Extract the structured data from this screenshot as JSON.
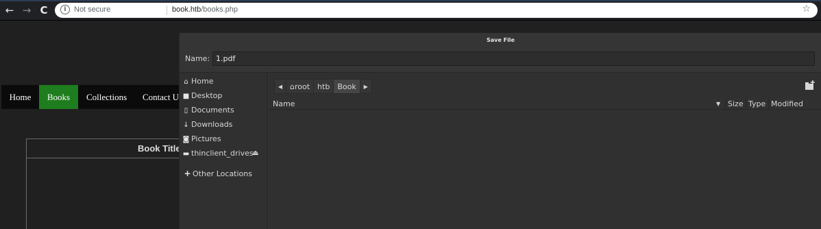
{
  "browser": {
    "back_icon": "arrow-left-icon",
    "forward_icon": "arrow-right-icon",
    "reload_icon": "reload-icon",
    "security_label": "Not secure",
    "url_host": "book.htb",
    "url_path": "/books.php",
    "bookmark_icon": "star-icon"
  },
  "site": {
    "nav": [
      {
        "label": "Home"
      },
      {
        "label": "Books",
        "active": true
      },
      {
        "label": "Collections"
      },
      {
        "label": "Contact Us"
      }
    ],
    "active_color": "#1e7d1e",
    "table_header": "Book Title"
  },
  "dialog": {
    "title": "Save File",
    "name_label": "Name:",
    "name_value": "1.pdf",
    "places": [
      {
        "label": "Home",
        "icon": "home-icon"
      },
      {
        "label": "Desktop",
        "icon": "folder-icon"
      },
      {
        "label": "Documents",
        "icon": "document-icon"
      },
      {
        "label": "Downloads",
        "icon": "download-icon"
      },
      {
        "label": "Pictures",
        "icon": "camera-icon"
      },
      {
        "label": "thinclient_drives",
        "icon": "drive-icon"
      }
    ],
    "other_locations": "Other Locations",
    "path": [
      "root",
      "htb",
      "Book"
    ],
    "columns": {
      "name": "Name",
      "size": "Size",
      "type": "Type",
      "modified": "Modified"
    }
  }
}
